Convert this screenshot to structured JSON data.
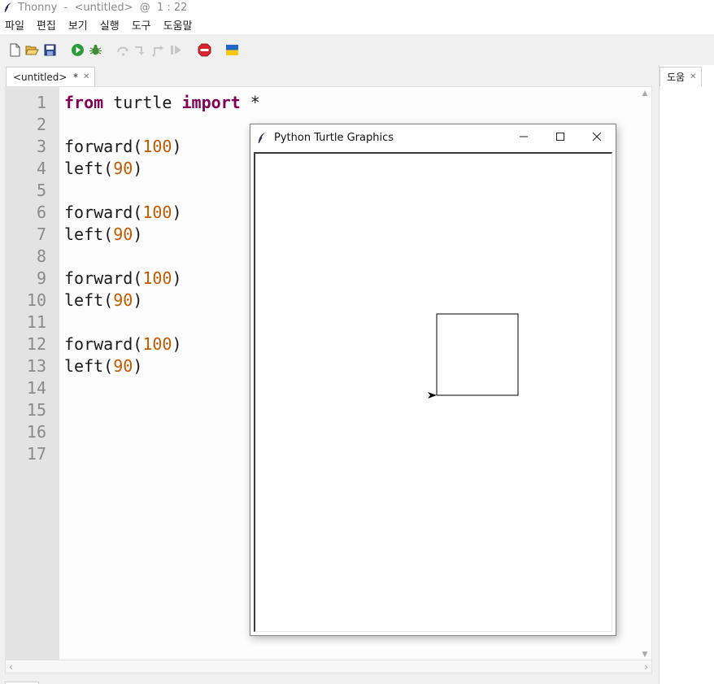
{
  "window": {
    "app_name": "Thonny",
    "file_name": "<untitled>",
    "cursor": "1 : 22",
    "title_text": "Thonny  -  <untitled>  @  1 : 22"
  },
  "menu": [
    "파일",
    "편집",
    "보기",
    "실행",
    "도구",
    "도움말"
  ],
  "toolbar": {
    "buttons": [
      "new-file-icon",
      "open-file-icon",
      "save-icon",
      "run-icon",
      "debug-icon",
      "step-over-icon",
      "step-into-icon",
      "step-out-icon",
      "resume-icon",
      "stop-icon",
      "ukraine-flag-icon"
    ],
    "disabled": [
      "step-over-icon",
      "step-into-icon",
      "step-out-icon",
      "resume-icon"
    ]
  },
  "editor": {
    "tab_label": "<untitled>  *",
    "line_numbers": [
      "1",
      "2",
      "3",
      "4",
      "5",
      "6",
      "7",
      "8",
      "9",
      "10",
      "11",
      "12",
      "13",
      "14",
      "15",
      "16",
      "17"
    ],
    "code_lines": [
      [
        {
          "t": "kw",
          "s": "from"
        },
        {
          "t": "fn",
          "s": " turtle "
        },
        {
          "t": "kw",
          "s": "import"
        },
        {
          "t": "fn",
          "s": " *"
        }
      ],
      [],
      [
        {
          "t": "fn",
          "s": "forward"
        },
        {
          "t": "pn",
          "s": "("
        },
        {
          "t": "num",
          "s": "100"
        },
        {
          "t": "pn",
          "s": ")"
        }
      ],
      [
        {
          "t": "fn",
          "s": "left"
        },
        {
          "t": "pn",
          "s": "("
        },
        {
          "t": "num",
          "s": "90"
        },
        {
          "t": "pn",
          "s": ")"
        }
      ],
      [],
      [
        {
          "t": "fn",
          "s": "forward"
        },
        {
          "t": "pn",
          "s": "("
        },
        {
          "t": "num",
          "s": "100"
        },
        {
          "t": "pn",
          "s": ")"
        }
      ],
      [
        {
          "t": "fn",
          "s": "left"
        },
        {
          "t": "pn",
          "s": "("
        },
        {
          "t": "num",
          "s": "90"
        },
        {
          "t": "pn",
          "s": ")"
        }
      ],
      [],
      [
        {
          "t": "fn",
          "s": "forward"
        },
        {
          "t": "pn",
          "s": "("
        },
        {
          "t": "num",
          "s": "100"
        },
        {
          "t": "pn",
          "s": ")"
        }
      ],
      [
        {
          "t": "fn",
          "s": "left"
        },
        {
          "t": "pn",
          "s": "("
        },
        {
          "t": "num",
          "s": "90"
        },
        {
          "t": "pn",
          "s": ")"
        }
      ],
      [],
      [
        {
          "t": "fn",
          "s": "forward"
        },
        {
          "t": "pn",
          "s": "("
        },
        {
          "t": "num",
          "s": "100"
        },
        {
          "t": "pn",
          "s": ")"
        }
      ],
      [
        {
          "t": "fn",
          "s": "left"
        },
        {
          "t": "pn",
          "s": "("
        },
        {
          "t": "num",
          "s": "90"
        },
        {
          "t": "pn",
          "s": ")"
        }
      ],
      [],
      [],
      [],
      []
    ]
  },
  "help_panel": {
    "tab_label": "도움"
  },
  "turtle_window": {
    "title": "Python Turtle Graphics",
    "square_side": 100,
    "turtle_heading_deg": 180
  },
  "colors": {
    "keyword": "#7f0055",
    "number": "#c25a00",
    "gutter": "#e3e3e3",
    "chrome": "#f0f0f0"
  }
}
